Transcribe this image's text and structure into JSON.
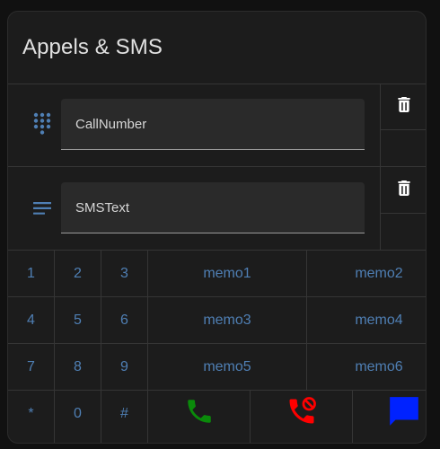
{
  "card": {
    "title": "Appels & SMS"
  },
  "call_field": {
    "value": "CallNumber",
    "icon": "dialpad-icon"
  },
  "sms_field": {
    "value": "SMSText",
    "icon": "text-lines-icon"
  },
  "keypad": {
    "rows": [
      {
        "digits": [
          "1",
          "2",
          "3"
        ],
        "memos": [
          "memo1",
          "memo2"
        ]
      },
      {
        "digits": [
          "4",
          "5",
          "6"
        ],
        "memos": [
          "memo3",
          "memo4"
        ]
      },
      {
        "digits": [
          "7",
          "8",
          "9"
        ],
        "memos": [
          "memo5",
          "memo6"
        ]
      },
      {
        "digits": [
          "*",
          "0",
          "#"
        ]
      }
    ]
  },
  "actions": {
    "call_icon": "phone-icon",
    "hangup_icon": "phone-hangup-icon",
    "sms_icon": "message-icon"
  },
  "colors": {
    "keypad_text": "#4f7fb4",
    "call": "#0a8a0a",
    "hangup": "#ff0000",
    "sms": "#0022ff"
  }
}
